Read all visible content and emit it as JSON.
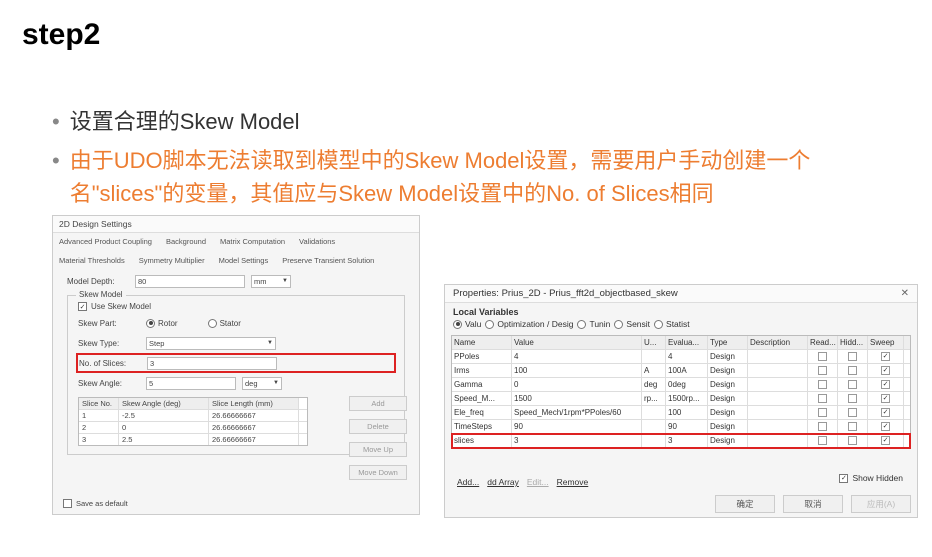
{
  "title": "step2",
  "bullet1": "设置合理的Skew Model",
  "bullet2": "由于UDO脚本无法读取到模型中的Skew Model设置，需要用户手动创建一个名\"slices\"的变量，其值应与Skew Model设置中的No. of Slices相同",
  "left": {
    "window_title": "2D Design Settings",
    "tabs": [
      "Advanced Product Coupling",
      "Background",
      "Matrix Computation",
      "Validations",
      "Material Thresholds",
      "Symmetry Multiplier",
      "Model Settings",
      "Preserve Transient Solution"
    ],
    "model_depth_label": "Model Depth:",
    "model_depth_value": "80",
    "model_depth_unit": "mm",
    "group_title": "Skew Model",
    "use_skew": "Use Skew Model",
    "skew_part_label": "Skew Part:",
    "skew_part_opts": [
      "Rotor",
      "Stator"
    ],
    "skew_type_label": "Skew Type:",
    "skew_type_value": "Step",
    "no_slices_label": "No. of Slices:",
    "no_slices_value": "3",
    "skew_angle_label": "Skew Angle:",
    "skew_angle_value": "5",
    "skew_angle_unit": "deg",
    "slice_headers": [
      "Slice No.",
      "Skew Angle (deg)",
      "Slice Length (mm)"
    ],
    "slices": [
      {
        "no": "1",
        "ang": "-2.5",
        "len": "26.66666667"
      },
      {
        "no": "2",
        "ang": "0",
        "len": "26.66666667"
      },
      {
        "no": "3",
        "ang": "2.5",
        "len": "26.66666667"
      }
    ],
    "btns": [
      "Add",
      "Delete",
      "Move Up",
      "Move Down"
    ],
    "save_default": "Save as default"
  },
  "right": {
    "title": "Properties: Prius_2D - Prius_fft2d_objectbased_skew",
    "tab_label": "Local Variables",
    "tabs": [
      "Valu",
      "Optimization / Desig",
      "Tunin",
      "Sensit",
      "Statist"
    ],
    "headers": [
      "Name",
      "Value",
      "U...",
      "Evalua...",
      "Type",
      "Description",
      "Read...",
      "Hidd...",
      "Sweep"
    ],
    "rows": [
      {
        "name": "PPoles",
        "value": "4",
        "u": "",
        "eval": "4",
        "type": "Design"
      },
      {
        "name": "Irms",
        "value": "100",
        "u": "A",
        "eval": "100A",
        "type": "Design"
      },
      {
        "name": "Gamma",
        "value": "0",
        "u": "deg",
        "eval": "0deg",
        "type": "Design"
      },
      {
        "name": "Speed_M...",
        "value": "1500",
        "u": "rp...",
        "eval": "1500rp...",
        "type": "Design"
      },
      {
        "name": "Ele_freq",
        "value": "Speed_Mech/1rpm*PPoles/60",
        "u": "",
        "eval": "100",
        "type": "Design"
      },
      {
        "name": "TimeSteps",
        "value": "90",
        "u": "",
        "eval": "90",
        "type": "Design"
      },
      {
        "name": "slices",
        "value": "3",
        "u": "",
        "eval": "3",
        "type": "Design"
      }
    ],
    "show_hidden": "Show Hidden",
    "foot_links": [
      "Add...",
      "dd Array",
      "Edit...",
      "Remove"
    ],
    "dlg_btns": [
      "确定",
      "取消",
      "应用(A)"
    ]
  }
}
